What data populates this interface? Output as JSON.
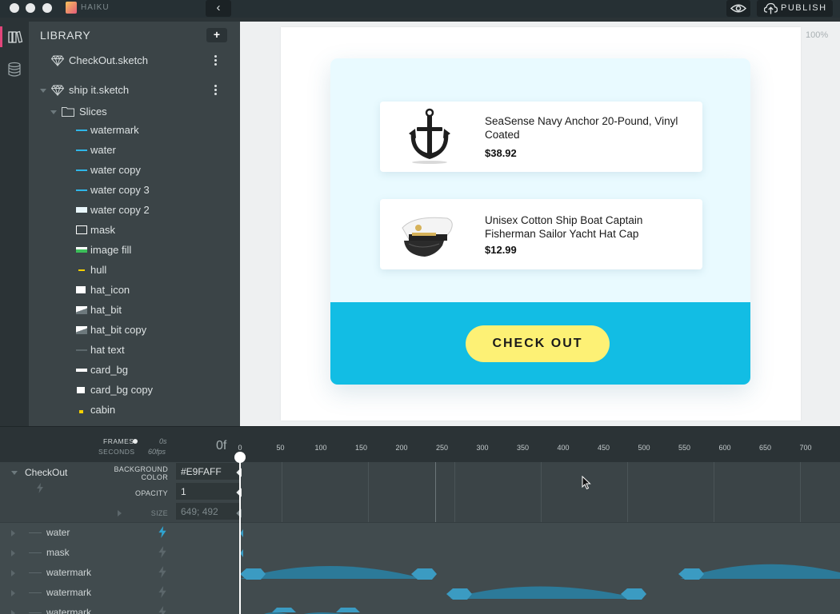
{
  "window": {
    "brand_name": "HAIKU",
    "publish_label": "PUBLISH",
    "back_glyph": "‹"
  },
  "icons": {
    "rail": [
      "library-icon",
      "database-icon"
    ],
    "brand": "haiku-logo-icon",
    "preview": "eye-icon",
    "publish": "cloud-upload-icon"
  },
  "library": {
    "title": "LIBRARY",
    "add_label": "+",
    "files": [
      {
        "name": "CheckOut.sketch"
      },
      {
        "name": "ship it.sketch"
      }
    ],
    "folder": {
      "name": "Slices"
    },
    "slices": [
      {
        "name": "watermark",
        "color": "#2fb6e8"
      },
      {
        "name": "water",
        "color": "#2fb6e8"
      },
      {
        "name": "water copy",
        "color": "#2fb6e8"
      },
      {
        "name": "water copy 3",
        "color": "#2fb6e8"
      },
      {
        "name": "water copy 2",
        "color": "#e8f6fb"
      },
      {
        "name": "mask",
        "color": "#ffffff"
      },
      {
        "name": "image fill",
        "color": "#3cbf5a"
      },
      {
        "name": "hull",
        "color": "#f5d000"
      },
      {
        "name": "hat_icon",
        "color": "#ffffff"
      },
      {
        "name": "hat_bit",
        "color": "#ffffff"
      },
      {
        "name": "hat_bit copy",
        "color": "#ffffff"
      },
      {
        "name": "hat text",
        "color": "#5c676b"
      },
      {
        "name": "card_bg",
        "color": "#ffffff"
      },
      {
        "name": "card_bg copy",
        "color": "#ffffff"
      },
      {
        "name": "cabin",
        "color": "#f5d000"
      }
    ]
  },
  "stage": {
    "zoom": "100%",
    "background_color": "#E9FAFF",
    "products": [
      {
        "name": "SeaSense Navy Anchor 20-Pound, Vinyl Coated",
        "price": "$38.92",
        "image": "anchor-image"
      },
      {
        "name": "Unisex Cotton Ship Boat Captain Fisherman Sailor Yacht Hat Cap",
        "price": "$12.99",
        "image": "captain-hat-image"
      }
    ],
    "checkout_label": "CHECK OUT"
  },
  "timeline": {
    "frames_label": "FRAMES",
    "seconds_label": "SECONDS",
    "seconds_value": "0s",
    "fps_value": "60fps",
    "current_frame": "0f",
    "ticks": [
      "0",
      "50",
      "100",
      "150",
      "200",
      "250",
      "300",
      "350",
      "400",
      "450",
      "500",
      "550",
      "600",
      "650",
      "700"
    ],
    "component": {
      "name": "CheckOut",
      "properties": [
        {
          "label": "BACKGROUND COLOR",
          "value": "#E9FAFF"
        },
        {
          "label": "OPACITY",
          "value": "1"
        },
        {
          "label": "SIZE",
          "value": "649; 492"
        }
      ]
    },
    "layers": [
      {
        "name": "water"
      },
      {
        "name": "mask"
      },
      {
        "name": "watermark"
      },
      {
        "name": "watermark"
      },
      {
        "name": "watermark"
      }
    ]
  }
}
